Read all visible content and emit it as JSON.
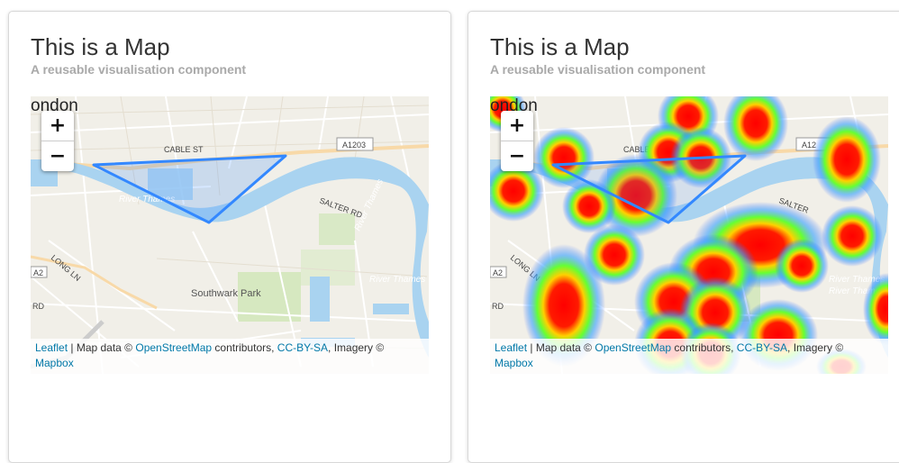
{
  "cards": [
    {
      "title": "This is a Map",
      "subtitle": "A reusable visualisation component",
      "map": {
        "zoom_in": "+",
        "zoom_out": "−",
        "place_label": "ondon",
        "road_labels": [
          "CABLE ST",
          "A1203",
          "SALTER RD",
          "LONG LN",
          "A2",
          "RD"
        ],
        "river_labels": [
          "River Thames",
          "River Thames",
          "River Thames"
        ],
        "park_label": "Southwark Park",
        "attribution": {
          "leaflet": "Leaflet",
          "sep": " | Map data © ",
          "osm": "OpenStreetMap",
          "contrib": " contributors, ",
          "license": "CC-BY-SA",
          "imagery": ", Imagery © ",
          "mapbox": "Mapbox"
        }
      }
    },
    {
      "title": "This is a Map",
      "subtitle": "A reusable visualisation component",
      "map": {
        "zoom_in": "+",
        "zoom_out": "−",
        "place_label": "ondon",
        "road_labels": [
          "CABLE S",
          "A12",
          "SALTER",
          "LONG LN",
          "A2",
          "RD"
        ],
        "river_labels": [
          "River Thames",
          "River Thames"
        ],
        "attribution": {
          "leaflet": "Leaflet",
          "sep": " | Map data © ",
          "osm": "OpenStreetMap",
          "contrib": " contributors, ",
          "license": "CC-BY-SA",
          "imagery": ", Imagery © ",
          "mapbox": "Mapbox"
        }
      }
    }
  ],
  "colors": {
    "water": "#a9d3f0",
    "polygon": "#3388ff",
    "link": "#0078a8",
    "heat_core": "#ff0000"
  }
}
